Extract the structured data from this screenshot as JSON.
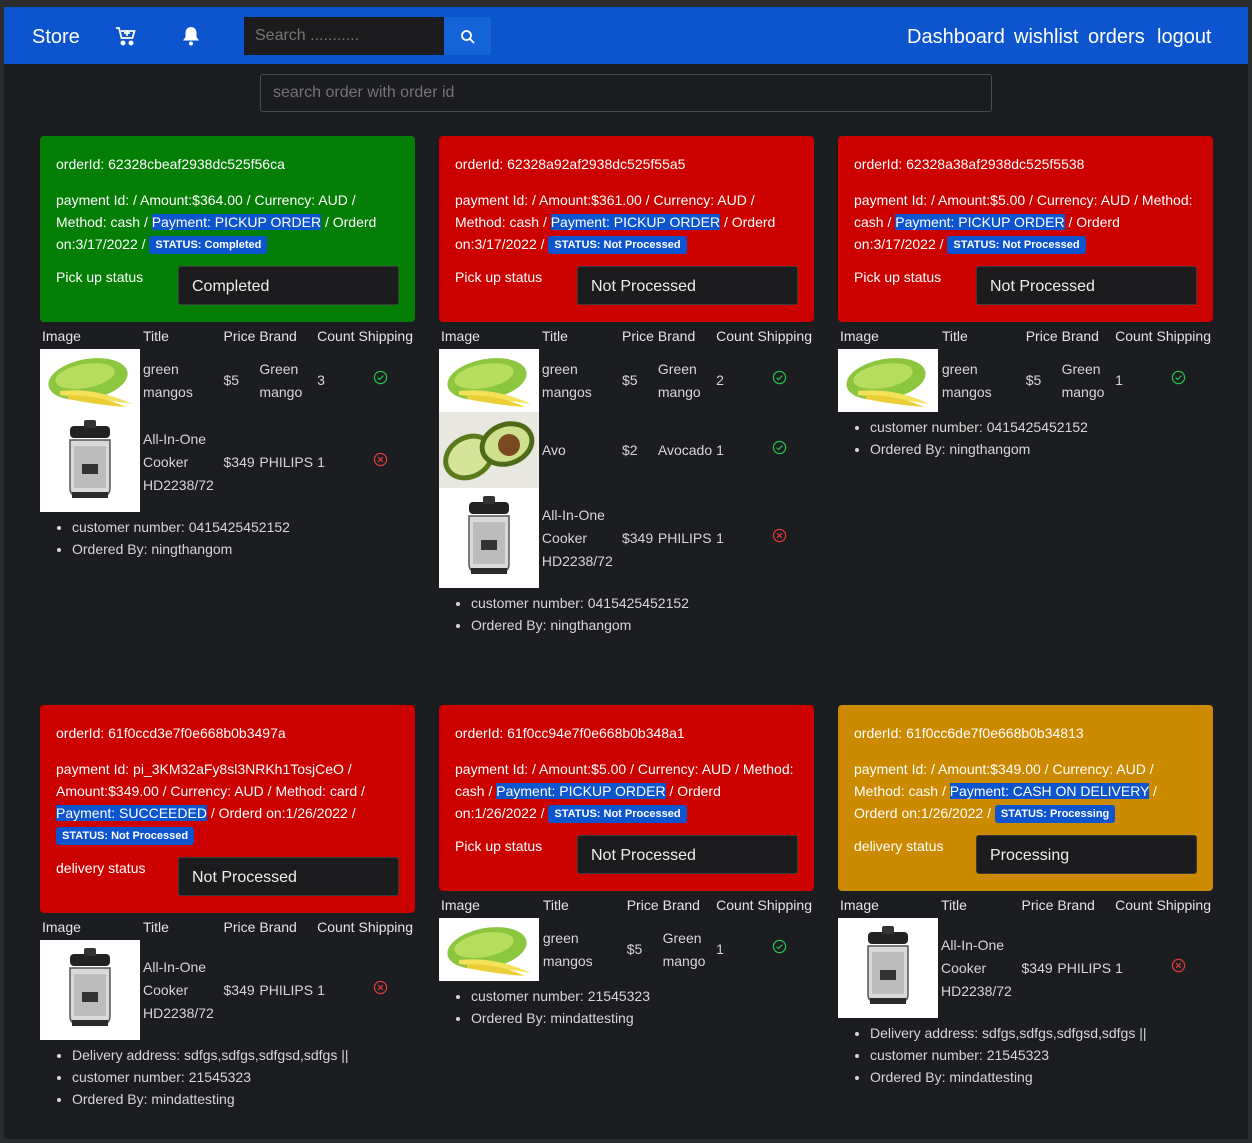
{
  "nav": {
    "brand": "Store",
    "search_placeholder": "Search ...........",
    "links": [
      "Dashboard",
      "wishlist",
      "orders",
      "logout"
    ]
  },
  "order_search_placeholder": "search order with order id",
  "table_headers": [
    "Image",
    "Title",
    "Price",
    "Brand",
    "Count",
    "Shipping"
  ],
  "colors": {
    "navbar": "#0d55cf",
    "completed": "#047e05",
    "not_processed": "#cd0000",
    "processing": "#cc8a00"
  },
  "orders": [
    {
      "order_id": "orderId: 62328cbeaf2938dc525f56ca",
      "payment_pre": "payment Id: / Amount:$364.00 / Currency: AUD / Method: cash / ",
      "payment_hl": "Payment: PICKUP ORDER",
      "payment_post": " / Orderd on:3/17/2022 / ",
      "status_badge": "STATUS: Completed",
      "status_label": "Pick up status",
      "status_value": "Completed",
      "items": [
        {
          "image": "mango",
          "title": "green mangos",
          "price": "$5",
          "brand": "Green mango",
          "count": "3",
          "shipping": "check-circle-icon"
        },
        {
          "image": "cooker",
          "title": "All-In-One Cooker HD2238/72",
          "price": "$349",
          "brand": "PHILIPS",
          "count": "1",
          "shipping": "x-circle-icon"
        }
      ],
      "info": [
        "customer number: 0415425452152",
        "Ordered By: ningthangom"
      ]
    },
    {
      "order_id": "orderId: 62328a92af2938dc525f55a5",
      "payment_pre": "payment Id: / Amount:$361.00 / Currency: AUD / Method: cash / ",
      "payment_hl": "Payment: PICKUP ORDER",
      "payment_post": " / Orderd on:3/17/2022 / ",
      "status_badge": "STATUS: Not Processed",
      "status_label": "Pick up status",
      "status_value": "Not Processed",
      "items": [
        {
          "image": "mango",
          "title": "green mangos",
          "price": "$5",
          "brand": "Green mango",
          "count": "2",
          "shipping": "check-circle-icon"
        },
        {
          "image": "avocado",
          "title": "Avo",
          "price": "$2",
          "brand": "Avocado",
          "count": "1",
          "shipping": "check-circle-icon"
        },
        {
          "image": "cooker",
          "title": "All-In-One Cooker HD2238/72",
          "price": "$349",
          "brand": "PHILIPS",
          "count": "1",
          "shipping": "x-circle-icon"
        }
      ],
      "info": [
        "customer number: 0415425452152",
        "Ordered By: ningthangom"
      ]
    },
    {
      "order_id": "orderId: 62328a38af2938dc525f5538",
      "payment_pre": "payment Id: / Amount:$5.00 / Currency: AUD / Method: cash / ",
      "payment_hl": "Payment: PICKUP ORDER",
      "payment_post": " / Orderd on:3/17/2022 / ",
      "status_badge": "STATUS: Not Processed",
      "status_label": "Pick up status",
      "status_value": "Not Processed",
      "items": [
        {
          "image": "mango",
          "title": "green mangos",
          "price": "$5",
          "brand": "Green mango",
          "count": "1",
          "shipping": "check-circle-icon"
        }
      ],
      "info": [
        "customer number: 0415425452152",
        "Ordered By: ningthangom"
      ]
    },
    {
      "order_id": "orderId: 61f0ccd3e7f0e668b0b3497a",
      "payment_pre": "payment Id: pi_3KM32aFy8sl3NRKh1TosjCeO / Amount:$349.00 / Currency: AUD / Method: card / ",
      "payment_hl": "Payment: SUCCEEDED",
      "payment_post": " / Orderd on:1/26/2022 / ",
      "status_badge": "STATUS: Not Processed",
      "status_label": "delivery status",
      "status_value": "Not Processed",
      "items": [
        {
          "image": "cooker",
          "title": "All-In-One Cooker HD2238/72",
          "price": "$349",
          "brand": "PHILIPS",
          "count": "1",
          "shipping": "x-circle-icon"
        }
      ],
      "info": [
        "Delivery address: sdfgs,sdfgs,sdfgsd,sdfgs ||",
        "customer number: 21545323",
        "Ordered By: mindattesting"
      ]
    },
    {
      "order_id": "orderId: 61f0cc94e7f0e668b0b348a1",
      "payment_pre": "payment Id: / Amount:$5.00 / Currency: AUD / Method: cash / ",
      "payment_hl": "Payment: PICKUP ORDER",
      "payment_post": " / Orderd on:1/26/2022 / ",
      "status_badge": "STATUS: Not Processed",
      "status_label": "Pick up status",
      "status_value": "Not Processed",
      "items": [
        {
          "image": "mango",
          "title": "green mangos",
          "price": "$5",
          "brand": "Green mango",
          "count": "1",
          "shipping": "check-circle-icon"
        }
      ],
      "info": [
        "customer number: 21545323",
        "Ordered By: mindattesting"
      ]
    },
    {
      "order_id": "orderId: 61f0cc6de7f0e668b0b34813",
      "payment_pre": "payment Id: / Amount:$349.00 / Currency: AUD / Method: cash / ",
      "payment_hl": "Payment: CASH ON DELIVERY",
      "payment_post": " / Orderd on:1/26/2022 / ",
      "status_badge": "STATUS: Processing",
      "status_label": "delivery status",
      "status_value": "Processing",
      "items": [
        {
          "image": "cooker",
          "title": "All-In-One Cooker HD2238/72",
          "price": "$349",
          "brand": "PHILIPS",
          "count": "1",
          "shipping": "x-circle-icon"
        }
      ],
      "info": [
        "Delivery address: sdfgs,sdfgs,sdfgsd,sdfgs ||",
        "customer number: 21545323",
        "Ordered By: mindattesting"
      ]
    }
  ]
}
